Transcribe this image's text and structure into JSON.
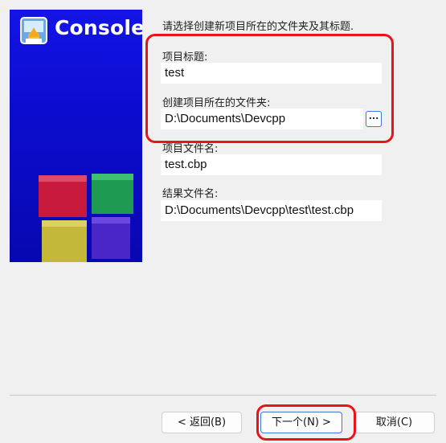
{
  "banner": {
    "title": "Console"
  },
  "instruction": "请选择创建新项目所在的文件夹及其标题.",
  "fields": {
    "project_title_label": "项目标题:",
    "project_title_value": "test",
    "folder_label": "创建项目所在的文件夹:",
    "folder_value": "D:\\Documents\\Devcpp",
    "browse_label": "...",
    "project_file_label": "项目文件名:",
    "project_file_value": "test.cbp",
    "result_file_label": "结果文件名:",
    "result_file_value": "D:\\Documents\\Devcpp\\test\\test.cbp"
  },
  "buttons": {
    "back": "< 返回(B)",
    "next": "下一个(N) >",
    "cancel": "取消(C)"
  },
  "colors": {
    "banner_blue": "#1010d8",
    "highlight_red": "#e8141a"
  }
}
